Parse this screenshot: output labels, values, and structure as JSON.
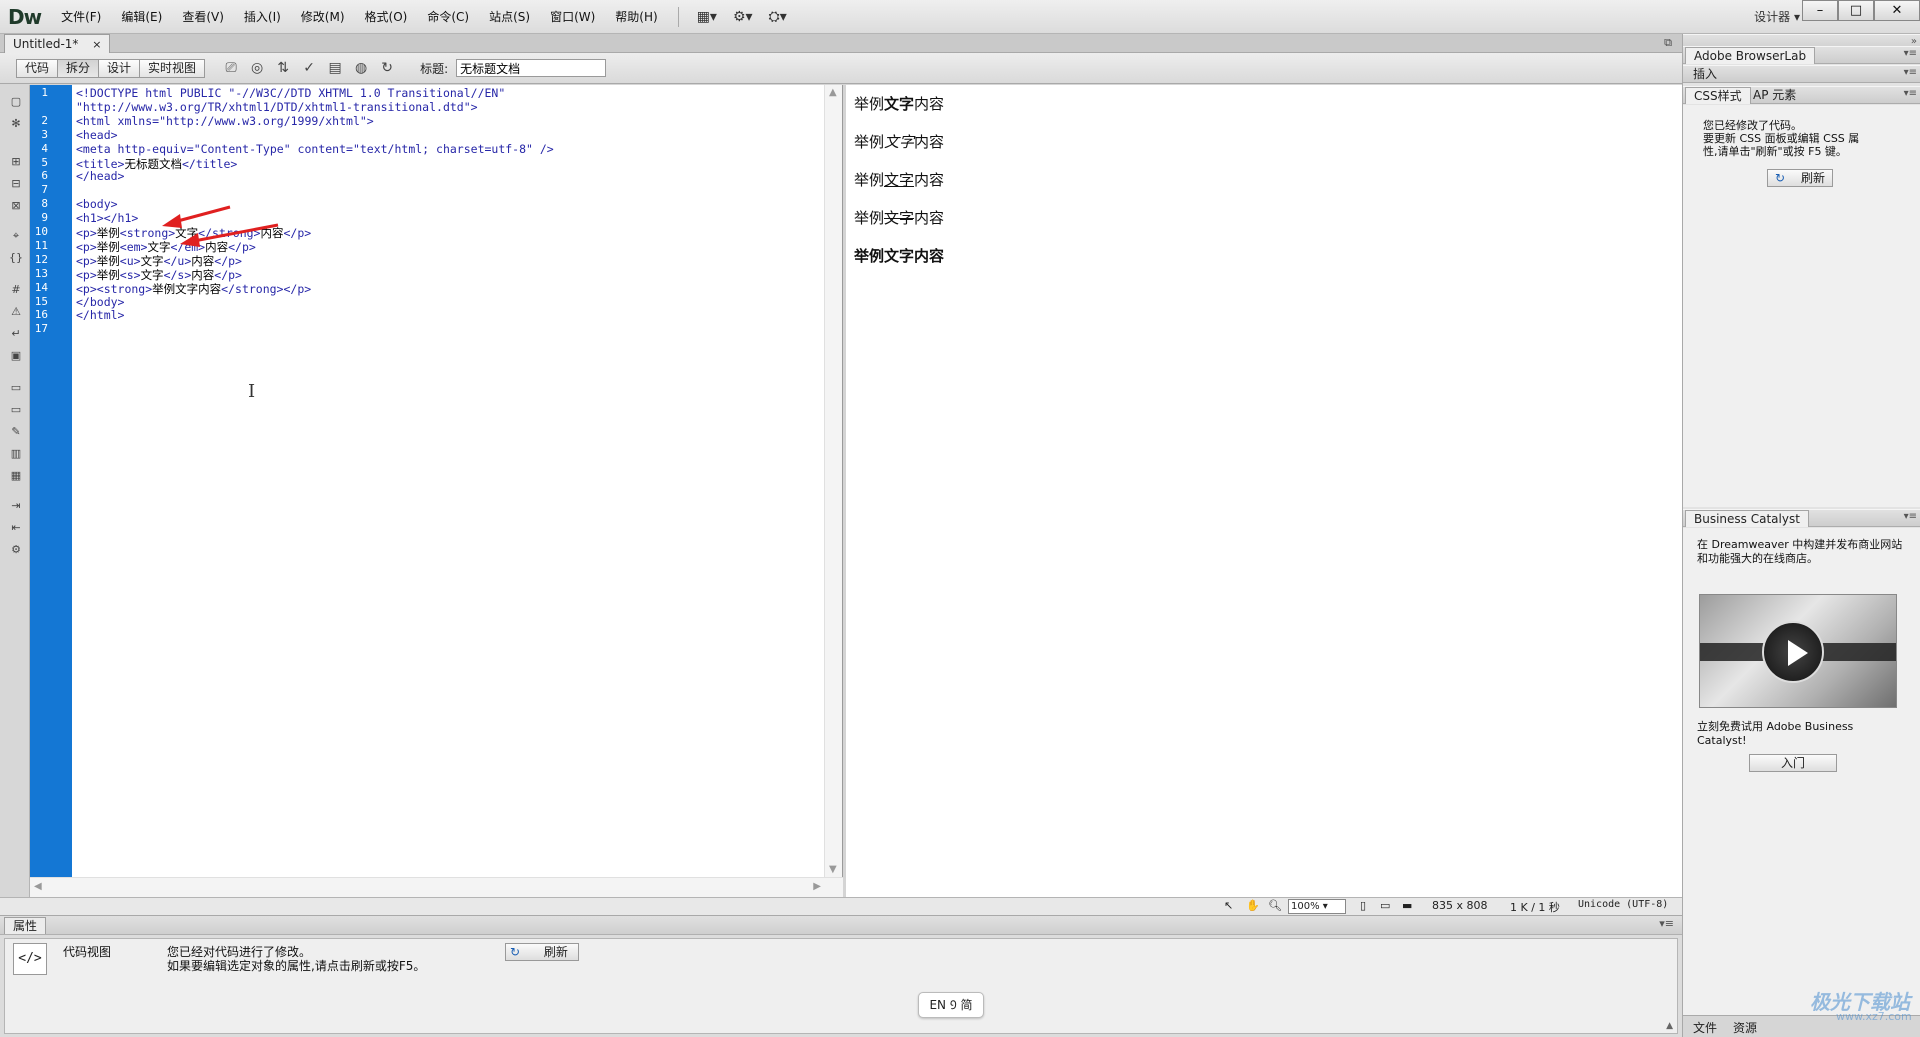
{
  "app": {
    "logo": "Dw",
    "menu": [
      "文件(F)",
      "编辑(E)",
      "查看(V)",
      "插入(I)",
      "修改(M)",
      "格式(O)",
      "命令(C)",
      "站点(S)",
      "窗口(W)",
      "帮助(H)"
    ],
    "workspace_label": "设计器",
    "win_minimize": "–",
    "win_maximize": "□",
    "win_close": "✕"
  },
  "document": {
    "tab_name": "Untitled-1*",
    "tab_close": "×"
  },
  "doc_toolbar": {
    "view_buttons": [
      "代码",
      "拆分",
      "设计",
      "实时视图"
    ],
    "title_label": "标题:",
    "title_value": "无标题文档"
  },
  "code": {
    "lines": [
      {
        "n": "1",
        "parts": [
          {
            "t": "<!DOCTYPE html PUBLIC \"-//W3C//DTD XHTML 1.0 Transitional//EN\"",
            "c": "tg"
          }
        ]
      },
      {
        "n": "",
        "parts": [
          {
            "t": "\"http://www.w3.org/TR/xhtml1/DTD/xhtml1-transitional.dtd\">",
            "c": "tg"
          }
        ]
      },
      {
        "n": "2",
        "parts": [
          {
            "t": "<html xmlns=\"http://www.w3.org/1999/xhtml\">",
            "c": "tg"
          }
        ]
      },
      {
        "n": "3",
        "parts": [
          {
            "t": "<head>",
            "c": "tg"
          }
        ]
      },
      {
        "n": "4",
        "parts": [
          {
            "t": "<meta http-equiv=\"Content-Type\" content=\"text/html; charset=utf-8\" />",
            "c": "tg"
          }
        ]
      },
      {
        "n": "5",
        "parts": [
          {
            "t": "<title>",
            "c": "tg"
          },
          {
            "t": "无标题文档",
            "c": ""
          },
          {
            "t": "</title>",
            "c": "tg"
          }
        ]
      },
      {
        "n": "6",
        "parts": [
          {
            "t": "</head>",
            "c": "tg"
          }
        ]
      },
      {
        "n": "7",
        "parts": []
      },
      {
        "n": "8",
        "parts": [
          {
            "t": "<body>",
            "c": "tg"
          }
        ]
      },
      {
        "n": "9",
        "parts": [
          {
            "t": "<h1></h1>",
            "c": "tg"
          }
        ]
      },
      {
        "n": "10",
        "parts": [
          {
            "t": "<p>",
            "c": "tg"
          },
          {
            "t": "举例",
            "c": ""
          },
          {
            "t": "<strong>",
            "c": "tg"
          },
          {
            "t": "文字",
            "c": ""
          },
          {
            "t": "</strong>",
            "c": "tg"
          },
          {
            "t": "内容",
            "c": ""
          },
          {
            "t": "</p>",
            "c": "tg"
          }
        ]
      },
      {
        "n": "11",
        "parts": [
          {
            "t": "<p>",
            "c": "tg"
          },
          {
            "t": "举例",
            "c": ""
          },
          {
            "t": "<em>",
            "c": "tg"
          },
          {
            "t": "文字",
            "c": ""
          },
          {
            "t": "</em>",
            "c": "tg"
          },
          {
            "t": "内容",
            "c": ""
          },
          {
            "t": "</p>",
            "c": "tg"
          }
        ]
      },
      {
        "n": "12",
        "parts": [
          {
            "t": "<p>",
            "c": "tg"
          },
          {
            "t": "举例",
            "c": ""
          },
          {
            "t": "<u>",
            "c": "tg"
          },
          {
            "t": "文字",
            "c": ""
          },
          {
            "t": "</u>",
            "c": "tg"
          },
          {
            "t": "内容",
            "c": ""
          },
          {
            "t": "</p>",
            "c": "tg"
          }
        ]
      },
      {
        "n": "13",
        "parts": [
          {
            "t": "<p>",
            "c": "tg"
          },
          {
            "t": "举例",
            "c": ""
          },
          {
            "t": "<s>",
            "c": "tg"
          },
          {
            "t": "文字",
            "c": ""
          },
          {
            "t": "</s>",
            "c": "tg"
          },
          {
            "t": "内容",
            "c": ""
          },
          {
            "t": "</p>",
            "c": "tg"
          }
        ]
      },
      {
        "n": "14",
        "parts": [
          {
            "t": "<p><strong>",
            "c": "tg"
          },
          {
            "t": "举例文字内容",
            "c": ""
          },
          {
            "t": "</strong></p>",
            "c": "tg"
          }
        ]
      },
      {
        "n": "15",
        "parts": [
          {
            "t": "</body>",
            "c": "tg"
          }
        ]
      },
      {
        "n": "16",
        "parts": [
          {
            "t": "</html>",
            "c": "tg"
          }
        ]
      },
      {
        "n": "17",
        "parts": []
      }
    ]
  },
  "design": {
    "paragraphs": [
      {
        "pre": "举例",
        "mid": "文字",
        "post": "内容",
        "style": "strong"
      },
      {
        "pre": "举例",
        "mid": "文字",
        "post": "内容",
        "style": "em"
      },
      {
        "pre": "举例",
        "mid": "文字",
        "post": "内容",
        "style": "u"
      },
      {
        "pre": "举例",
        "mid": "文字",
        "post": "内容",
        "style": "s"
      },
      {
        "pre": "",
        "mid": "举例文字内容",
        "post": "",
        "style": "strong-all"
      }
    ]
  },
  "status": {
    "zoom": "100%",
    "dimensions": "835 x 808",
    "size_time": "1 K / 1 秒",
    "encoding": "Unicode (UTF-8)"
  },
  "properties": {
    "tab": "属性",
    "view_label": "代码视图",
    "message_line1": "您已经对代码进行了修改。",
    "message_line2": "如果要编辑选定对象的属性,请点击刷新或按F5。",
    "refresh_label": "刷新",
    "ime": "EN ᠑ 简"
  },
  "right_panels": {
    "browserlab": "Adobe BrowserLab",
    "insert": "插入",
    "css_tab": "CSS样式",
    "ap_tab": "AP 元素",
    "css_msg1": "您已经修改了代码。",
    "css_msg2": "要更新 CSS 面板或编辑 CSS 属",
    "css_msg3": "性,请单击\"刷新\"或按 F5 键。",
    "css_refresh": "刷新",
    "bc_title": "Business Catalyst",
    "bc_msg1": "在 Dreamweaver 中构建并发布商业网站",
    "bc_msg2": "和功能强大的在线商店。",
    "bc_try1": "立刻免费试用 Adobe Business",
    "bc_try2": "Catalyst!",
    "bc_button": "入门",
    "bottom_tab_files": "文件",
    "bottom_tab_assets": "资源",
    "watermark": "极光下载站",
    "watermark_url": "www.xz7.com"
  },
  "colors": {
    "gutter": "#1477d4",
    "code_tag": "#2727a8",
    "arrow": "#e02020"
  }
}
